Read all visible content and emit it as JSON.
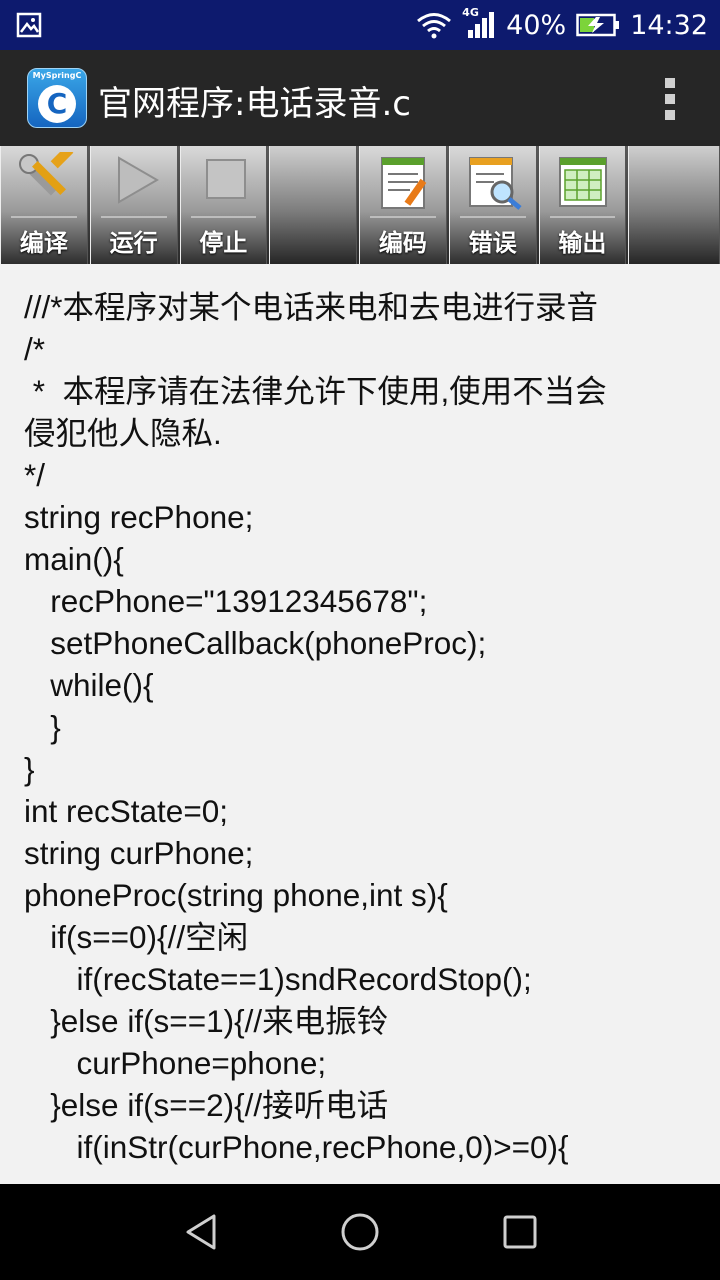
{
  "status_bar": {
    "network_type": "4G",
    "battery_percent": "40%",
    "time": "14:32",
    "icons": [
      "gallery-icon",
      "wifi-icon",
      "cellular-signal-icon",
      "battery-charging-icon"
    ]
  },
  "app_bar": {
    "logo_text": "MySpringC",
    "logo_letter": "C",
    "title": "官网程序:电话录音.c"
  },
  "toolbar": {
    "compile": "编译",
    "run": "运行",
    "stop": "停止",
    "encode": "编码",
    "error": "错误",
    "output": "输出"
  },
  "code_lines": [
    "///*本程序对某个电话来电和去电进行录音",
    "/*",
    " *  本程序请在法律允许下使用,使用不当会",
    "侵犯他人隐私.",
    "*/",
    "string recPhone;",
    "main(){",
    "   recPhone=\"13912345678\";",
    "   setPhoneCallback(phoneProc);",
    "   while(){",
    "   }",
    "}",
    "int recState=0;",
    "string curPhone;",
    "phoneProc(string phone,int s){",
    "   if(s==0){//空闲",
    "      if(recState==1)sndRecordStop();",
    "   }else if(s==1){//来电振铃",
    "      curPhone=phone;",
    "   }else if(s==2){//接听电话",
    "      if(inStr(curPhone,recPhone,0)>=0){"
  ],
  "nav_bar": {
    "icons": [
      "back-icon",
      "home-icon",
      "recents-icon"
    ]
  }
}
